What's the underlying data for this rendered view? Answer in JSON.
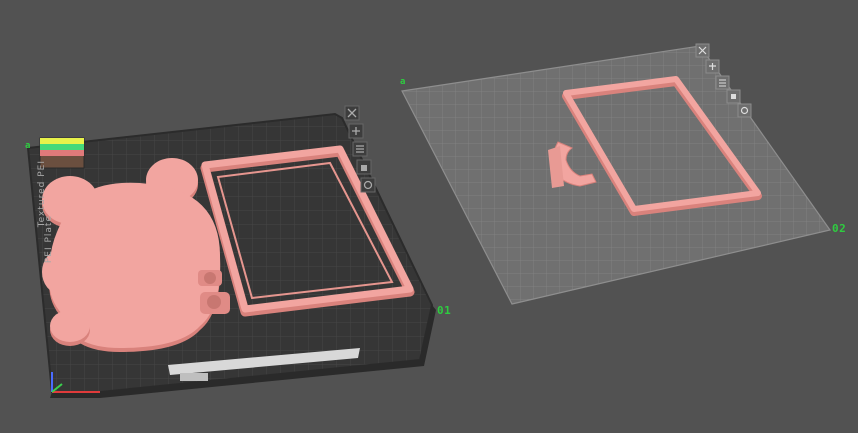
{
  "app": {
    "scene": "slicer-3d-preview"
  },
  "colors": {
    "background": "#525252",
    "plate_dark": "#333333",
    "plate_dark_grid": "#474747",
    "plate_light": "#7a7a7a",
    "plate_light_grid": "#8c8c8c",
    "model": "#f2a5a0",
    "model_edge": "#d9827c",
    "label": "#2ecc40"
  },
  "plates": [
    {
      "id": "plate-01",
      "label": "01",
      "selected": true,
      "style": "textured-dark",
      "models": [
        "bear-shape",
        "rectangular-frame",
        "hinge-part"
      ]
    },
    {
      "id": "plate-02",
      "label": "02",
      "selected": false,
      "style": "translucent",
      "models": [
        "rectangular-frame",
        "clip-part"
      ]
    }
  ],
  "plate_tools": [
    {
      "icon": "close-icon"
    },
    {
      "icon": "arrange-icon"
    },
    {
      "icon": "layers-icon"
    },
    {
      "icon": "lock-icon"
    },
    {
      "icon": "settings-icon"
    }
  ],
  "side_text": {
    "part1": "Textured PEI",
    "part2": "PEI Plate"
  },
  "markers": {
    "left": "a",
    "right": "a"
  }
}
